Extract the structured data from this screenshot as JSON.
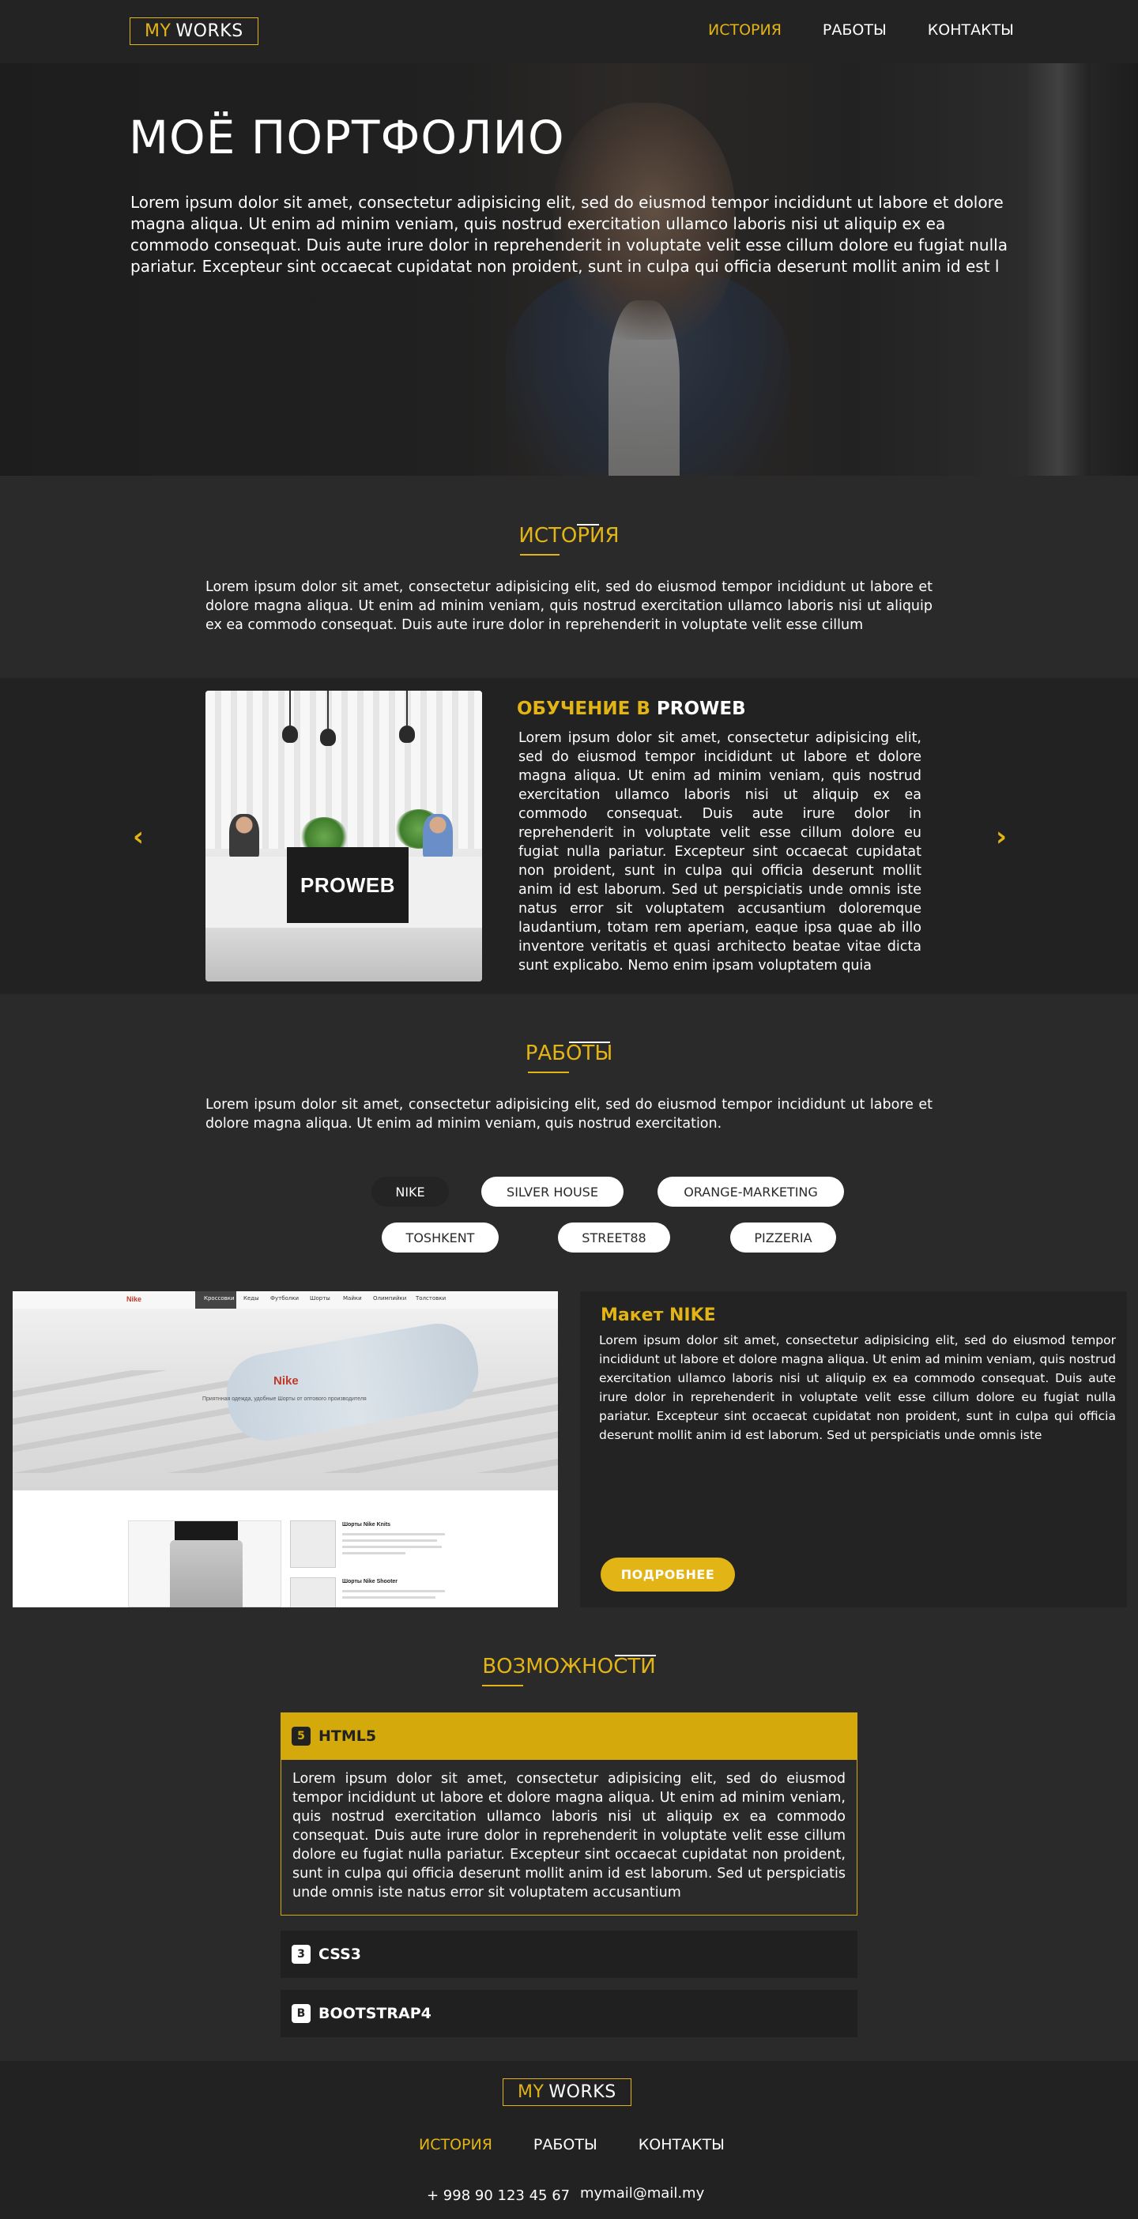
{
  "header": {
    "logo_my": "MY",
    "logo_works": "WORKS",
    "nav": [
      "ИСТОРИЯ",
      "РАБОТЫ",
      "КОНТАКТЫ"
    ]
  },
  "hero": {
    "title": "МОЁ ПОРТФОЛИО",
    "text": "Lorem ipsum dolor sit amet, consectetur adipisicing elit, sed do eiusmod tempor incididunt ut labore et dolore magna aliqua. Ut enim ad minim veniam, quis nostrud exercitation ullamco laboris nisi ut aliquip ex ea commodo consequat. Duis aute irure dolor in reprehenderit in voluptate velit esse cillum dolore eu fugiat nulla pariatur. Excepteur sint occaecat cupidatat non proident, sunt in culpa qui officia deserunt mollit anim id est l"
  },
  "history": {
    "title": "ИСТОРИЯ",
    "text": "Lorem ipsum dolor sit amet, consectetur adipisicing elit, sed do eiusmod tempor incididunt ut labore et dolore magna aliqua. Ut enim ad minim veniam, quis nostrud exercitation ullamco laboris nisi ut aliquip ex ea commodo consequat. Duis aute irure dolor in reprehenderit in voluptate velit esse cillum",
    "slide": {
      "image_label": "PROWEB",
      "heading_yellow": "ОБУЧЕНИЕ В",
      "heading_white": "PROWEB",
      "text": "Lorem ipsum dolor sit amet, consectetur adipisicing elit, sed do eiusmod tempor incididunt ut labore et dolore magna aliqua. Ut enim ad minim veniam, quis nostrud exercitation ullamco laboris nisi ut aliquip ex ea commodo consequat. Duis aute irure dolor in reprehenderit in voluptate velit esse cillum dolore eu fugiat nulla pariatur. Excepteur sint occaecat cupidatat non proident, sunt in culpa qui officia deserunt mollit anim id est laborum. Sed ut perspiciatis unde omnis iste natus error sit voluptatem accusantium doloremque laudantium, totam rem aperiam, eaque ipsa quae ab illo inventore veritatis et quasi architecto beatae vitae dicta sunt explicabo. Nemo enim ipsam voluptatem quia"
    }
  },
  "works": {
    "title": "РАБОТЫ",
    "text": "Lorem ipsum dolor sit amet, consectetur adipisicing elit, sed do eiusmod tempor incididunt ut labore et dolore magna aliqua. Ut enim ad minim veniam, quis nostrud exercitation.",
    "filters": [
      "NIKE",
      "SILVER HOUSE",
      "ORANGE-MARKETING",
      "TOSHKENT",
      "STREET88",
      "PIZZERIA"
    ],
    "active_filter": "NIKE",
    "card": {
      "screenshot": {
        "brand": "Nike",
        "menu": [
          "Кроссовки",
          "Кеды",
          "Футболки",
          "Шорты",
          "Майки",
          "Олимпийки",
          "Толстовки"
        ],
        "hero_title": "Nike",
        "hero_sub": "Приятнная одежда, удобные Шорты от оптового производителя",
        "item1_title": "Шорты Nike Knits",
        "item2_title": "Шорты Nike Shooter"
      },
      "title": "Макет NIKE",
      "text": "Lorem ipsum dolor sit amet, consectetur adipisicing elit, sed do eiusmod tempor incididunt ut labore et dolore magna aliqua. Ut enim ad minim veniam, quis nostrud exercitation ullamco laboris nisi ut aliquip ex ea commodo consequat. Duis aute irure dolor in reprehenderit in voluptate velit esse cillum dolore eu fugiat nulla pariatur. Excepteur sint occaecat cupidatat non proident, sunt in culpa qui officia deserunt mollit anim id est laborum. Sed ut perspiciatis unde omnis iste",
      "button": "ПОДРОБНЕЕ"
    }
  },
  "features": {
    "title": "ВОЗМОЖНОСТИ",
    "items": [
      {
        "label": "HTML5",
        "icon": "html5-icon",
        "glyph": "5"
      },
      {
        "label": "CSS3",
        "icon": "css3-icon",
        "glyph": "3"
      },
      {
        "label": "BOOTSTRAP4",
        "icon": "bootstrap-icon",
        "glyph": "B"
      }
    ],
    "open_text": "Lorem ipsum dolor sit amet, consectetur adipisicing elit, sed do eiusmod tempor incididunt ut labore et dolore magna aliqua. Ut enim ad minim veniam, quis nostrud exercitation ullamco laboris nisi ut aliquip ex ea commodo consequat. Duis aute irure dolor in reprehenderit in voluptate velit esse cillum dolore eu fugiat nulla pariatur. Excepteur sint occaecat cupidatat non proident, sunt in culpa qui officia deserunt mollit anim id est laborum. Sed ut perspiciatis unde omnis iste natus error sit voluptatem accusantium"
  },
  "footer": {
    "logo_my": "MY",
    "logo_works": "WORKS",
    "nav": [
      "ИСТОРИЯ",
      "РАБОТЫ",
      "КОНТАКТЫ"
    ],
    "phone": "+ 998 90 123 45 67",
    "email": "mymail@mail.my"
  },
  "colors": {
    "accent": "#e3b416",
    "accordion_open": "#d4a90c",
    "background": "#2a2a2a",
    "panel": "#222222"
  },
  "icons": [
    "chevron-left-icon",
    "chevron-right-icon",
    "html5-icon",
    "css3-icon",
    "bootstrap-icon"
  ]
}
